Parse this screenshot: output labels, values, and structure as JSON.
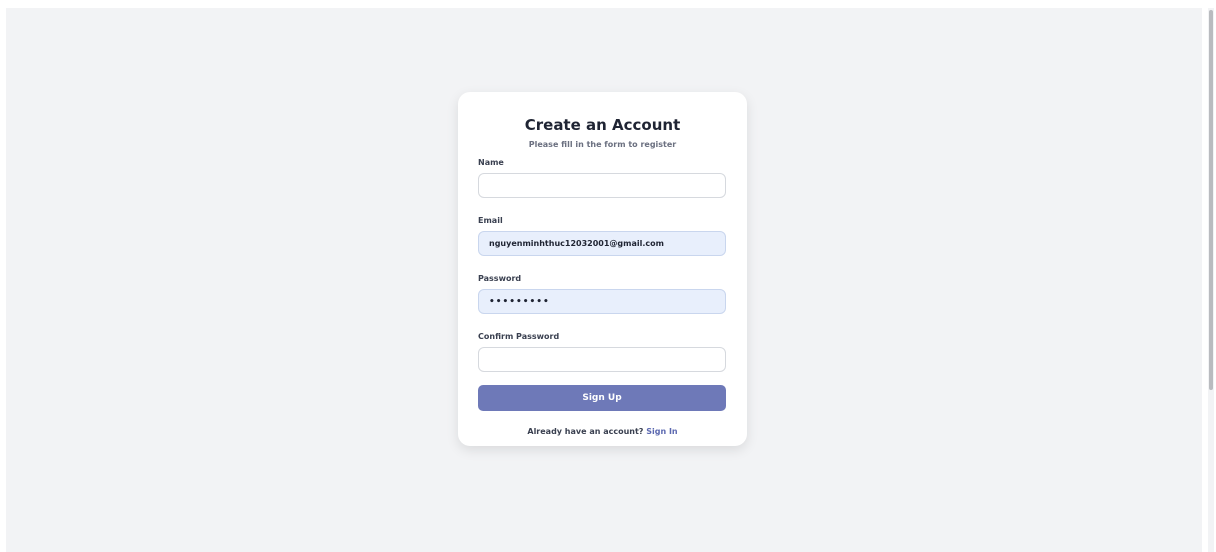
{
  "form": {
    "title": "Create an Account",
    "subtitle": "Please fill in the form to register",
    "name_label": "Name",
    "name_value": "",
    "email_label": "Email",
    "email_value": "nguyenminhthuc12032001@gmail.com",
    "password_label": "Password",
    "password_value": "•••••••••",
    "confirm_label": "Confirm Password",
    "confirm_value": "",
    "submit_label": "Sign Up",
    "signin_prompt": "Already have an account?",
    "signin_link": "Sign In"
  },
  "colors": {
    "page_background": "#f2f3f5",
    "button": "#6e79b8",
    "link": "#5b68b0",
    "autofill_background": "#e8effc"
  }
}
